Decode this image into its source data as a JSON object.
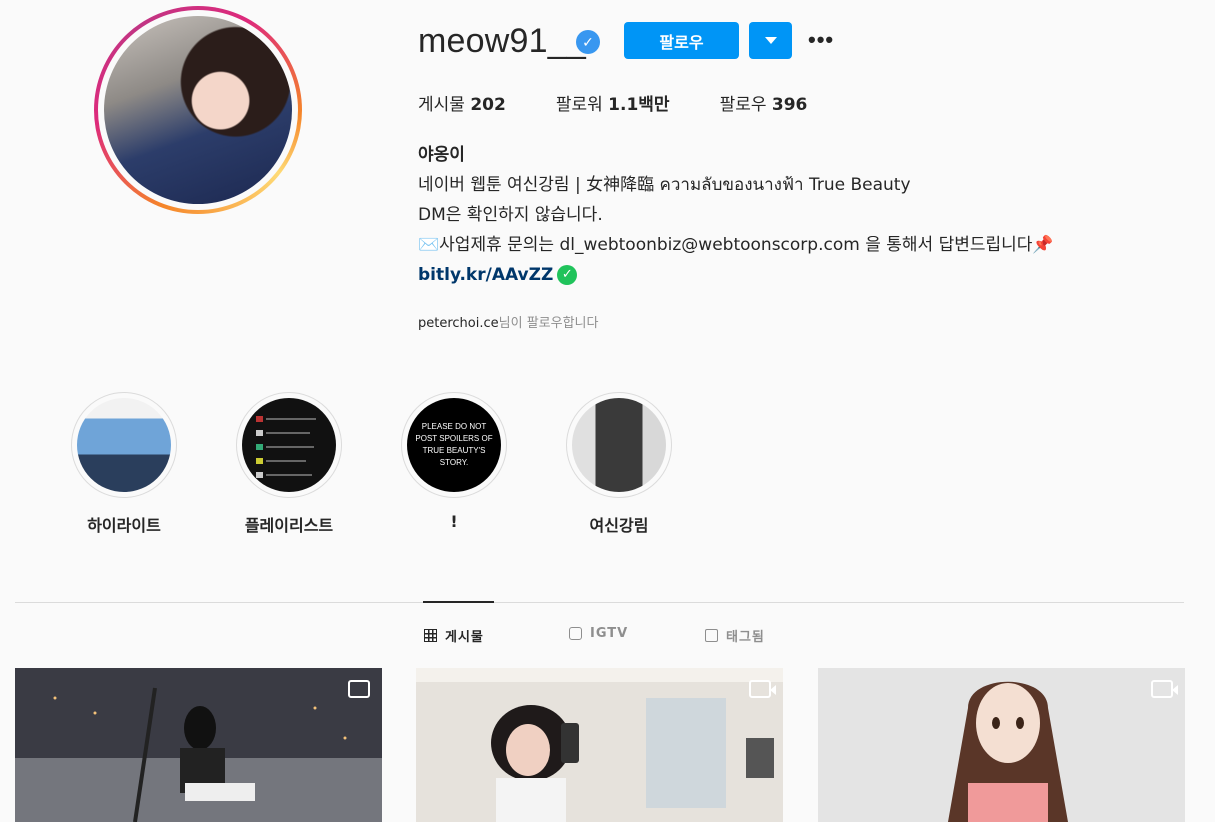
{
  "profile": {
    "username": "meow91__",
    "verified_mark": "✓",
    "follow_label": "팔로우",
    "more_label": "•••",
    "stats": {
      "posts_label": "게시물",
      "posts_value": "202",
      "followers_label": "팔로워",
      "followers_value": "1.1백만",
      "following_label": "팔로우",
      "following_value": "396"
    },
    "bio": {
      "name": "야옹이",
      "line1": "네이버 웹툰 여신강림 | 女神降臨 ความลับของนางฟ้า True Beauty",
      "line2": "DM은 확인하지 않습니다.",
      "line3": "✉️사업제휴 문의는 dl_webtoonbiz@webtoonscorp.com 을 통해서 답변드립니다📌",
      "link": "bitly.kr/AAvZZ",
      "link_check": "✓"
    },
    "followed_by_user": "peterchoi.ce",
    "followed_by_suffix": "님이 팔로우합니다"
  },
  "highlights": [
    {
      "label": "하이라이트"
    },
    {
      "label": "플레이리스트"
    },
    {
      "label": "!",
      "cover_text": "PLEASE DO NOT POST SPOILERS OF TRUE BEAUTY'S STORY."
    },
    {
      "label": "여신강림"
    }
  ],
  "tabs": [
    {
      "label": "게시물",
      "icon": "grid-icon",
      "active": true
    },
    {
      "label": "IGTV",
      "icon": "tv-icon",
      "active": false
    },
    {
      "label": "태그됨",
      "icon": "tag-icon",
      "active": false
    }
  ],
  "posts": [
    {
      "type": "multi",
      "icon": "carousel-icon"
    },
    {
      "type": "video",
      "icon": "video-icon"
    },
    {
      "type": "video",
      "icon": "video-icon"
    }
  ],
  "colors": {
    "accent": "#0095f6",
    "link": "#00376b",
    "text": "#262626",
    "muted": "#8e8e8e",
    "background": "#fafafa"
  }
}
